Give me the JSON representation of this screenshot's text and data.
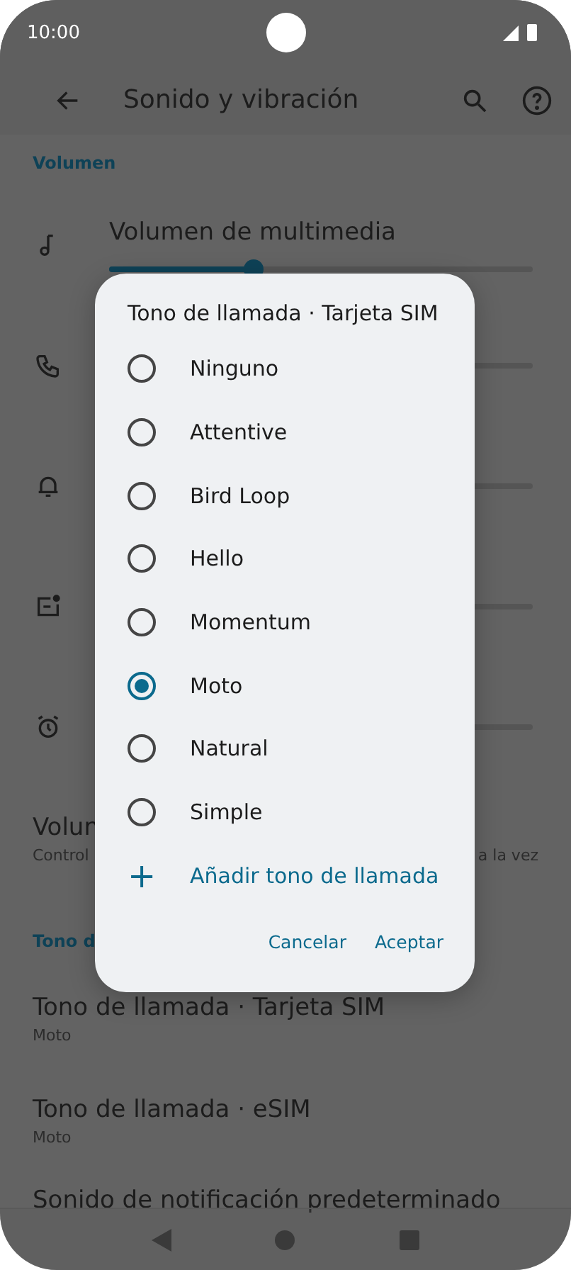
{
  "status_bar": {
    "time": "10:00"
  },
  "app_bar": {
    "title": "Sonido y vibración"
  },
  "volume_section": {
    "header": "Volumen",
    "sliders": [
      {
        "kind": "music",
        "title": "Volumen de multimedia",
        "level": 0.34
      },
      {
        "kind": "phone"
      },
      {
        "kind": "bell"
      },
      {
        "kind": "notification"
      },
      {
        "kind": "alarm"
      }
    ]
  },
  "volume_row": {
    "title": "Volun",
    "subtitle_left": "Control",
    "subtitle_right": "a la vez"
  },
  "ringtone_section": {
    "header": "Tono d",
    "rows": [
      {
        "title": "Tono de llamada · Tarjeta SIM",
        "subtitle": "Moto"
      },
      {
        "title": "Tono de llamada · eSIM",
        "subtitle": "Moto"
      },
      {
        "title": "Sonido de notificación predeterminado"
      }
    ]
  },
  "dialog": {
    "title": "Tono de llamada · Tarjeta SIM",
    "options": [
      {
        "label": "Ninguno",
        "selected": false
      },
      {
        "label": "Attentive",
        "selected": false
      },
      {
        "label": "Bird Loop",
        "selected": false
      },
      {
        "label": "Hello",
        "selected": false
      },
      {
        "label": "Momentum",
        "selected": false
      },
      {
        "label": "Moto",
        "selected": true
      },
      {
        "label": "Natural",
        "selected": false
      },
      {
        "label": "Simple",
        "selected": false
      }
    ],
    "add": {
      "icon": "+",
      "label": "Añadir tono de llamada"
    },
    "buttons": [
      "Cancelar",
      "Aceptar"
    ]
  }
}
